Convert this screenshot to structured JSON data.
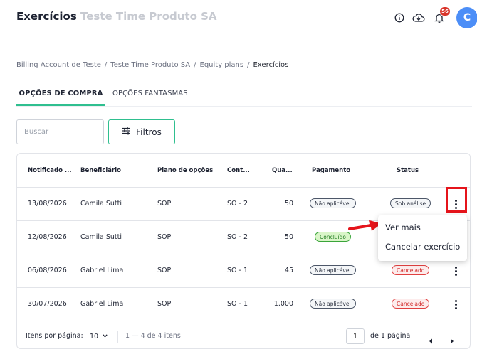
{
  "header": {
    "app_title": "Exercícios",
    "org_title": "Teste Time Produto SA",
    "notifications_count": "56",
    "avatar_initial": "C"
  },
  "breadcrumb": {
    "items": [
      "Billing Account de Teste",
      "Teste Time Produto SA",
      "Equity plans"
    ],
    "current": "Exercícios",
    "separator": "/"
  },
  "tabs": [
    {
      "label": "OPÇÕES DE COMPRA",
      "active": true
    },
    {
      "label": "OPÇÕES FANTASMAS",
      "active": false
    }
  ],
  "toolbar": {
    "search_placeholder": "Buscar",
    "filters_label": "Filtros"
  },
  "table": {
    "columns": [
      "Notificado ...",
      "Beneficiário",
      "Plano de opções",
      "Cont...",
      "Qua...",
      "Pagamento",
      "Status"
    ],
    "rows": [
      {
        "date": "13/08/2026",
        "beneficiary": "Camila Sutti",
        "plan": "SOP",
        "contract": "SO - 2",
        "quantity": "50",
        "payment": "Não aplicável",
        "payment_style": "na",
        "status": "Sob análise",
        "status_style": "analysis"
      },
      {
        "date": "12/08/2026",
        "beneficiary": "Camila Sutti",
        "plan": "SOP",
        "contract": "SO - 2",
        "quantity": "50",
        "payment": "Concluído",
        "payment_style": "done",
        "status": "",
        "status_style": ""
      },
      {
        "date": "06/08/2026",
        "beneficiary": "Gabriel Lima",
        "plan": "SOP",
        "contract": "SO - 1",
        "quantity": "45",
        "payment": "Não aplicável",
        "payment_style": "na",
        "status": "Cancelado",
        "status_style": "cancel"
      },
      {
        "date": "30/07/2026",
        "beneficiary": "Gabriel Lima",
        "plan": "SOP",
        "contract": "SO - 1",
        "quantity": "1.000",
        "payment": "Não aplicável",
        "payment_style": "na",
        "status": "Cancelado",
        "status_style": "cancel"
      }
    ]
  },
  "pagination": {
    "items_per_page_label": "Itens por página:",
    "items_per_page_value": "10",
    "range_text": "1 — 4 de 4 itens",
    "current_page": "1",
    "total_pages_text": "de 1 página"
  },
  "row_menu": {
    "items": [
      "Ver mais",
      "Cancelar exercício"
    ]
  },
  "colors": {
    "accent": "#2fbf8f",
    "annotation": "#e5141b",
    "avatar": "#4c8ef7",
    "badge": "#d9352b"
  }
}
